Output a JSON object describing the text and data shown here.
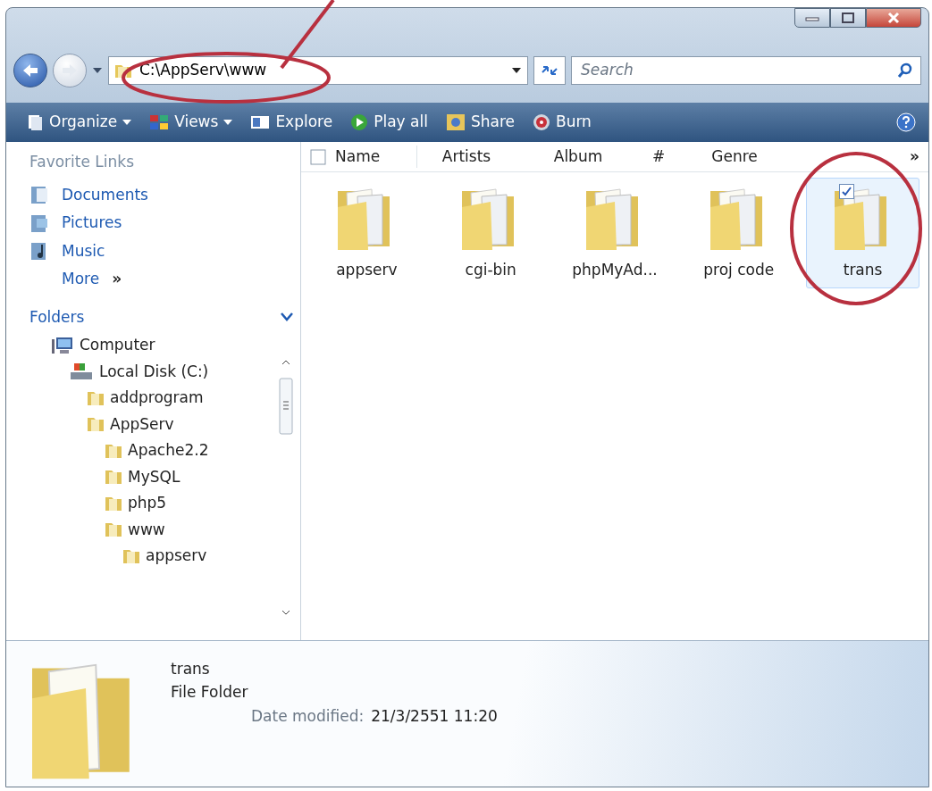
{
  "address": {
    "path": "C:\\AppServ\\www"
  },
  "search": {
    "placeholder": "Search"
  },
  "toolbar": [
    {
      "label": "Organize",
      "kind": "menu"
    },
    {
      "label": "Views",
      "kind": "menu"
    },
    {
      "label": "Explore",
      "kind": "button"
    },
    {
      "label": "Play all",
      "kind": "button"
    },
    {
      "label": "Share",
      "kind": "button"
    },
    {
      "label": "Burn",
      "kind": "button"
    }
  ],
  "favorite_links": {
    "title": "Favorite Links",
    "items": [
      {
        "label": "Documents"
      },
      {
        "label": "Pictures"
      },
      {
        "label": "Music"
      }
    ],
    "more": "More",
    "more_glyph": "»"
  },
  "folders": {
    "title": "Folders",
    "tree": [
      {
        "label": "Computer",
        "kind": "computer",
        "children": [
          {
            "label": "Local Disk (C:)",
            "kind": "drive",
            "children": [
              {
                "label": "addprogram",
                "kind": "folder"
              },
              {
                "label": "AppServ",
                "kind": "folder",
                "children": [
                  {
                    "label": "Apache2.2",
                    "kind": "folder"
                  },
                  {
                    "label": "MySQL",
                    "kind": "folder"
                  },
                  {
                    "label": "php5",
                    "kind": "folder"
                  },
                  {
                    "label": "www",
                    "kind": "folder",
                    "children": [
                      {
                        "label": "appserv",
                        "kind": "folder"
                      }
                    ]
                  }
                ]
              }
            ]
          }
        ]
      }
    ]
  },
  "columns": [
    "Name",
    "Artists",
    "Album",
    "#",
    "Genre"
  ],
  "select_all": {
    "checked": false
  },
  "more_columns": "»",
  "items": [
    {
      "name": "appserv",
      "selected": false
    },
    {
      "name": "cgi-bin",
      "selected": false
    },
    {
      "name": "phpMyAd...",
      "selected": false
    },
    {
      "name": "proj code",
      "selected": false
    },
    {
      "name": "trans",
      "selected": true
    }
  ],
  "details": {
    "name": "trans",
    "type": "File Folder",
    "date_label": "Date modified:",
    "date": "21/3/2551 11:20"
  }
}
